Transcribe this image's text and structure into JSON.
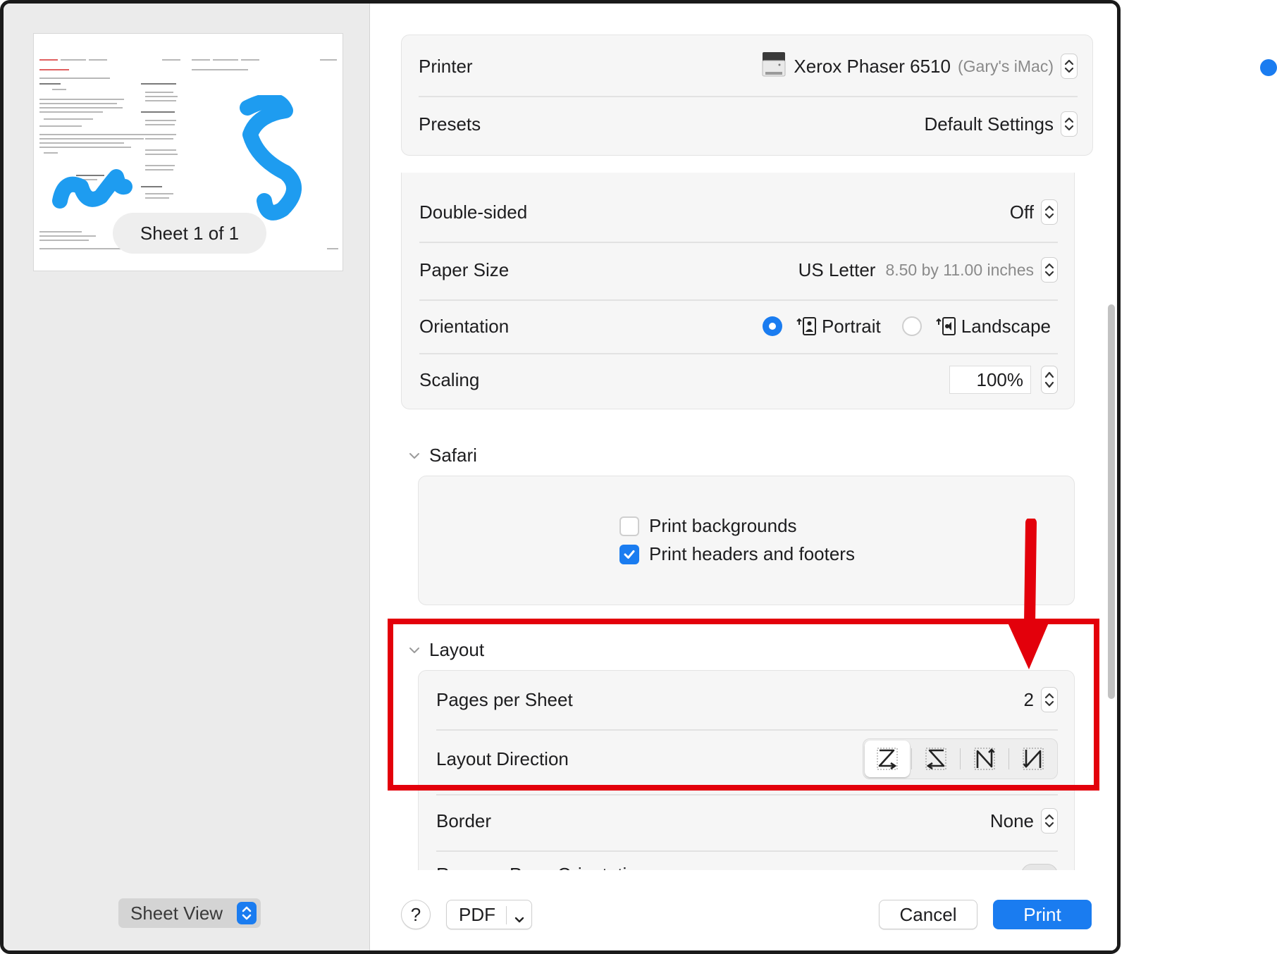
{
  "preview": {
    "sheet_label": "Sheet 1 of 1",
    "view_select": "Sheet View"
  },
  "printer": {
    "label": "Printer",
    "name": "Xerox Phaser 6510",
    "host": "(Gary's iMac)"
  },
  "presets": {
    "label": "Presets",
    "value": "Default Settings"
  },
  "double_sided": {
    "label": "Double-sided",
    "value": "Off"
  },
  "paper_size": {
    "label": "Paper Size",
    "value": "US Letter",
    "detail": "8.50 by 11.00 inches"
  },
  "orientation": {
    "label": "Orientation",
    "portrait": "Portrait",
    "landscape": "Landscape",
    "selected": "Portrait"
  },
  "scaling": {
    "label": "Scaling",
    "value": "100%"
  },
  "safari": {
    "title": "Safari",
    "print_backgrounds": "Print backgrounds",
    "print_backgrounds_checked": false,
    "print_headers_footers": "Print headers and footers",
    "print_headers_footers_checked": true
  },
  "layout": {
    "title": "Layout",
    "pages_per_sheet_label": "Pages per Sheet",
    "pages_per_sheet_value": "2",
    "layout_direction_label": "Layout Direction",
    "border_label": "Border",
    "border_value": "None",
    "reverse_orientation_label": "Reverse Page Orientation"
  },
  "footer": {
    "help": "?",
    "pdf": "PDF",
    "cancel": "Cancel",
    "print": "Print"
  },
  "colors": {
    "accent": "#1a7cf0",
    "annotation": "#e3000b"
  }
}
